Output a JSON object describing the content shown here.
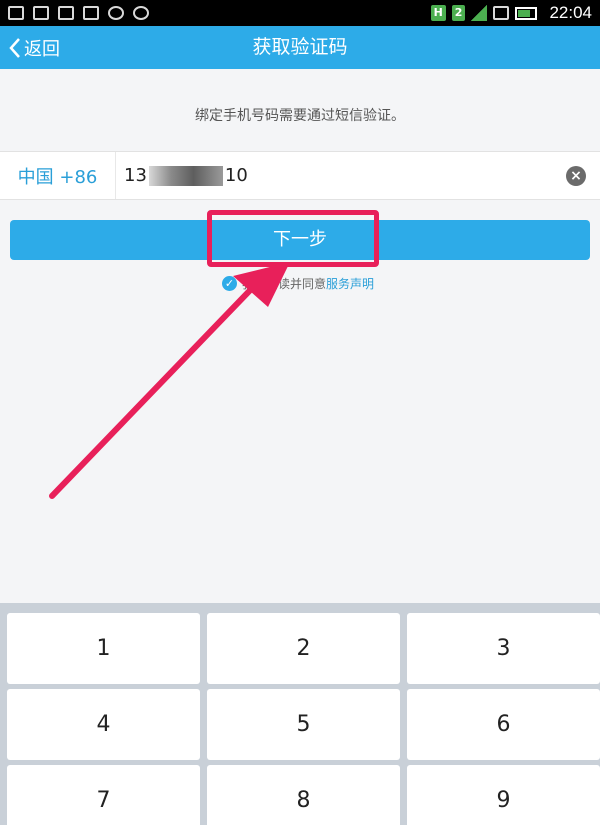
{
  "statusbar": {
    "time": "22:04",
    "network_badge": "H",
    "sim_badge": "2",
    "icons": [
      "shield-icon",
      "keyboard-icon",
      "sim-icon",
      "image-icon",
      "sync-icon",
      "lock-icon",
      "signal-icon",
      "wifi-icon",
      "battery-icon"
    ]
  },
  "titlebar": {
    "back_label": "返回",
    "title": "获取验证码"
  },
  "notice": "绑定手机号码需要通过短信验证。",
  "phone": {
    "country_code": "中国 +86",
    "prefix": "13",
    "suffix": "10"
  },
  "next_button": "下一步",
  "agreement": {
    "text": "我已阅读并同意",
    "link": "服务声明"
  },
  "keypad": {
    "keys": [
      "1",
      "2",
      "3",
      "4",
      "5",
      "6",
      "7",
      "8",
      "9"
    ]
  },
  "colors": {
    "accent": "#2dabe8",
    "annotation": "#e8205a"
  }
}
